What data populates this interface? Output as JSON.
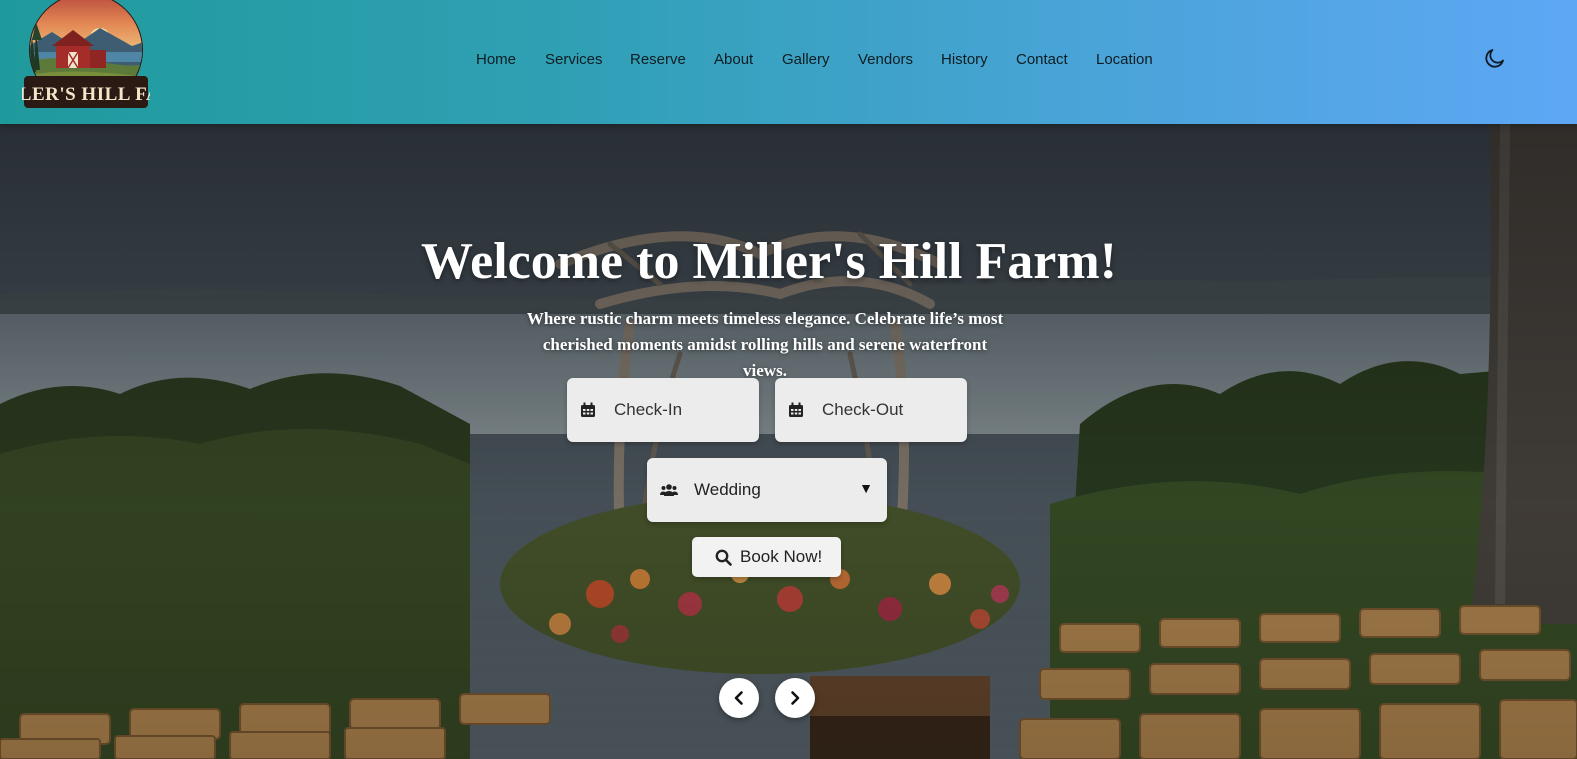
{
  "header": {
    "logo_text": "MILLER'S HILL FARM",
    "nav": [
      "Home",
      "Services",
      "Reserve",
      "About",
      "Gallery",
      "Vendors",
      "History",
      "Contact",
      "Location"
    ],
    "theme_toggle_icon": "moon-icon"
  },
  "hero": {
    "title": "Welcome to Miller's Hill Farm!",
    "subtitle": "Where rustic charm meets timeless elegance. Celebrate life’s most cherished moments amidst rolling hills and serene waterfront views.",
    "checkin": {
      "placeholder": "Check-In",
      "icon": "calendar-icon"
    },
    "checkout": {
      "placeholder": "Check-Out",
      "icon": "calendar-icon"
    },
    "event_type": {
      "selected": "Wedding",
      "icon": "users-icon"
    },
    "book_button": {
      "label": "Book Now!",
      "icon": "search-icon"
    },
    "prev_icon": "chevron-left-icon",
    "next_icon": "chevron-right-icon"
  },
  "colors": {
    "header_start": "#1f9a9c",
    "header_end": "#5ea7f5",
    "field_bg": "#ececec"
  }
}
